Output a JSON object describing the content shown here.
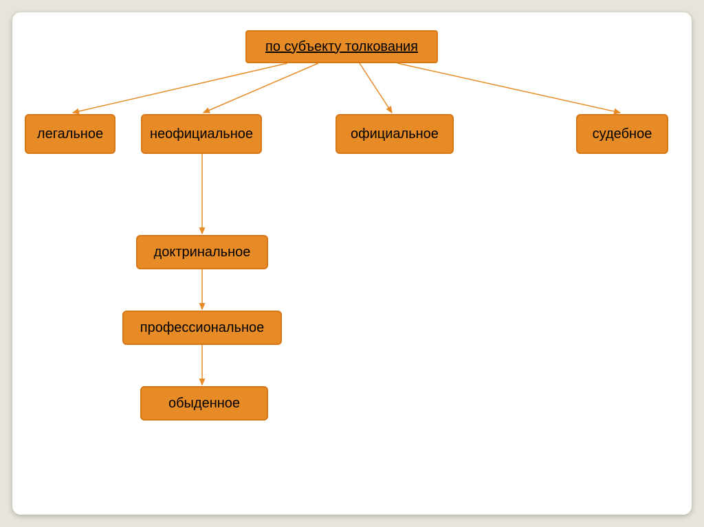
{
  "root": {
    "label": "по субъекту толкования"
  },
  "level1": {
    "legal": "легальное",
    "unofficial": "неофициальное",
    "official": "официальное",
    "judicial": "судебное"
  },
  "level2": {
    "doctrinal": "доктринальное",
    "professional": "профессиональное",
    "ordinary": "обыденное"
  },
  "colors": {
    "node_bg": "#e78b27",
    "node_border": "#d67614",
    "arrow": "#e78b27"
  }
}
